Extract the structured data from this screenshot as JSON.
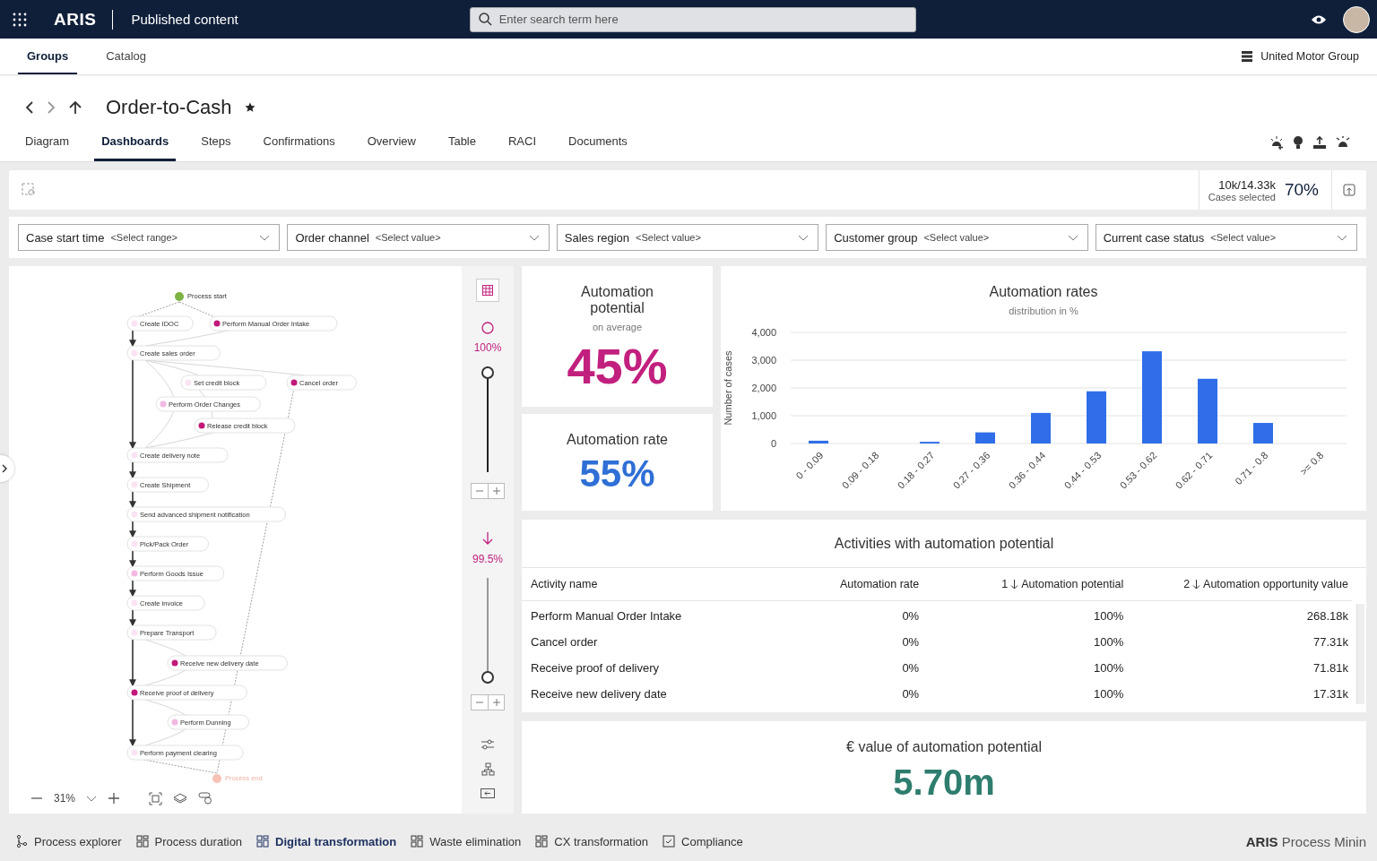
{
  "topbar": {
    "brand": "ARIS",
    "section": "Published content",
    "search": {
      "placeholder": "Enter search term here"
    }
  },
  "nav_tabs": [
    {
      "label": "Groups",
      "selected": true
    },
    {
      "label": "Catalog",
      "selected": false
    }
  ],
  "organization": "United Motor Group",
  "page": {
    "title": "Order-to-Cash",
    "favorite": true
  },
  "tabs": [
    {
      "label": "Diagram",
      "selected": false
    },
    {
      "label": "Dashboards",
      "selected": true
    },
    {
      "label": "Steps",
      "selected": false
    },
    {
      "label": "Confirmations",
      "selected": false
    },
    {
      "label": "Overview",
      "selected": false
    },
    {
      "label": "Table",
      "selected": false
    },
    {
      "label": "RACI",
      "selected": false
    },
    {
      "label": "Documents",
      "selected": false
    }
  ],
  "selection": {
    "cases": "10k/14.33k",
    "caption": "Cases selected",
    "percent": "70%"
  },
  "filters": [
    {
      "label": "Case start time",
      "placeholder": "<Select range>"
    },
    {
      "label": "Order channel",
      "placeholder": "<Select value>"
    },
    {
      "label": "Sales region",
      "placeholder": "<Select value>"
    },
    {
      "label": "Customer group",
      "placeholder": "<Select value>"
    },
    {
      "label": "Current case status",
      "placeholder": "<Select value>"
    }
  ],
  "process_map": {
    "zoom": "31%",
    "nodes": [
      {
        "kind": "start",
        "label": "Process start"
      },
      {
        "kind": "activity",
        "label": "Create IDOC",
        "color": "#fbe3f4"
      },
      {
        "kind": "activity",
        "label": "Perform Manual Order Intake",
        "color": "#c2187a"
      },
      {
        "kind": "activity",
        "label": "Create sales order",
        "color": "#fbe3f4"
      },
      {
        "kind": "activity",
        "label": "Set credit block",
        "color": "#fbe3f4"
      },
      {
        "kind": "activity",
        "label": "Cancel order",
        "color": "#c2187a"
      },
      {
        "kind": "activity",
        "label": "Perform Order Changes",
        "color": "#f2b8e2"
      },
      {
        "kind": "activity",
        "label": "Release credit block",
        "color": "#c2187a"
      },
      {
        "kind": "activity",
        "label": "Create delivery note",
        "color": "#fbe3f4"
      },
      {
        "kind": "activity",
        "label": "Create Shipment",
        "color": "#fbe3f4"
      },
      {
        "kind": "activity",
        "label": "Send advanced shipment notification",
        "color": "#fbe3f4"
      },
      {
        "kind": "activity",
        "label": "Pick/Pack Order",
        "color": "#fbe3f4"
      },
      {
        "kind": "activity",
        "label": "Perform Goods Issue",
        "color": "#f2b8e2"
      },
      {
        "kind": "activity",
        "label": "Create invoice",
        "color": "#fbe3f4"
      },
      {
        "kind": "activity",
        "label": "Prepare Transport",
        "color": "#fbe3f4"
      },
      {
        "kind": "activity",
        "label": "Receive new delivery date",
        "color": "#c2187a"
      },
      {
        "kind": "activity",
        "label": "Receive proof of delivery",
        "color": "#c2187a"
      },
      {
        "kind": "activity",
        "label": "Perform Dunning",
        "color": "#f2b8e2"
      },
      {
        "kind": "activity",
        "label": "Perform payment clearing",
        "color": "#fbe3f4"
      },
      {
        "kind": "end",
        "label": "Process end"
      }
    ]
  },
  "sliders": [
    {
      "reading": "100%",
      "level": 1
    },
    {
      "reading": "99.5%",
      "level": 0
    }
  ],
  "kpis": [
    {
      "title": "Automation potential",
      "subtitle": "on average",
      "value": "45%",
      "color": "#c2207e"
    },
    {
      "title": "Automation rate",
      "value": "55%",
      "color": "#2f6fd6"
    }
  ],
  "chart": {
    "title": "Automation rates",
    "subtitle": "distribution in %",
    "chart_data": {
      "type": "bar",
      "ylabel": "Number of cases",
      "categories": [
        "0 - 0.09",
        "0.09 - 0.18",
        "0.18 - 0.27",
        "0.27 - 0.36",
        "0.36 - 0.44",
        "0.44 - 0.53",
        "0.53 - 0.62",
        "0.62 - 0.71",
        "0.71 - 0.8",
        ">= 0.8"
      ],
      "grid": true,
      "series": [
        {
          "color": "#2f6ee8",
          "values": [
            100,
            0,
            60,
            400,
            1100,
            1880,
            3320,
            2330,
            740,
            0
          ]
        }
      ],
      "ylim": [
        0,
        4000
      ],
      "yticks": [
        {
          "value": 0,
          "label": "0"
        },
        {
          "value": 1000,
          "label": "1,000"
        },
        {
          "value": 2000,
          "label": "2,000"
        },
        {
          "value": 3000,
          "label": "3,000"
        },
        {
          "value": 4000,
          "label": "4,000"
        }
      ]
    }
  },
  "table": {
    "title": "Activities with automation potential",
    "columns": [
      {
        "label": "Activity name"
      },
      {
        "label": "Automation rate"
      },
      {
        "label": "Automation potential",
        "sort": "1"
      },
      {
        "label": "Automation opportunity value",
        "sort": "2"
      }
    ],
    "rows": [
      [
        "Perform Manual Order Intake",
        "0%",
        "100%",
        "268.18k"
      ],
      [
        "Cancel order",
        "0%",
        "100%",
        "77.31k"
      ],
      [
        "Receive proof of delivery",
        "0%",
        "100%",
        "71.81k"
      ],
      [
        "Receive new delivery date",
        "0%",
        "100%",
        "17.31k"
      ]
    ]
  },
  "value_card": {
    "title": "€ value of automation potential",
    "value": "5.70m"
  },
  "bottom_tabs": [
    {
      "label": "Process explorer",
      "kind": "explorer",
      "selected": false
    },
    {
      "label": "Process duration",
      "kind": "dashboard",
      "selected": false
    },
    {
      "label": "Digital transformation",
      "kind": "dashboard",
      "selected": true
    },
    {
      "label": "Waste elimination",
      "kind": "dashboard",
      "selected": false
    },
    {
      "label": "CX transformation",
      "kind": "dashboard",
      "selected": false
    },
    {
      "label": "Compliance",
      "kind": "check",
      "selected": false
    }
  ],
  "footer_brand": {
    "bold": "ARIS",
    "text": "Process Minin"
  }
}
